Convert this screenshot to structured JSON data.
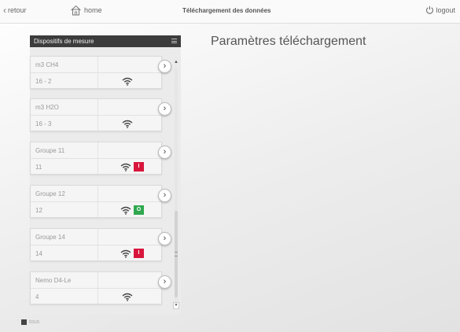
{
  "header": {
    "back_label": "retour",
    "home_label": "home",
    "title": "Téléchargement des données",
    "logout_label": "logout"
  },
  "sidebar": {
    "title": "Dispositifs de mesure",
    "devices": [
      {
        "name": "m3 CH4",
        "id": "16 - 2",
        "status": ""
      },
      {
        "name": "m3 H2O",
        "id": "16 - 3",
        "status": ""
      },
      {
        "name": "Groupe 11",
        "id": "11",
        "status": "I"
      },
      {
        "name": "Groupe 12",
        "id": "12",
        "status": "O"
      },
      {
        "name": "Groupe 14",
        "id": "14",
        "status": "I"
      },
      {
        "name": "Nemo D4-Le",
        "id": "4",
        "status": ""
      }
    ],
    "footer_label": "tous"
  },
  "main": {
    "title": "Paramètres téléchargement"
  },
  "colors": {
    "status_I": "#d8163c",
    "status_O": "#2fa84f",
    "header_bg": "#3c3c3c"
  }
}
